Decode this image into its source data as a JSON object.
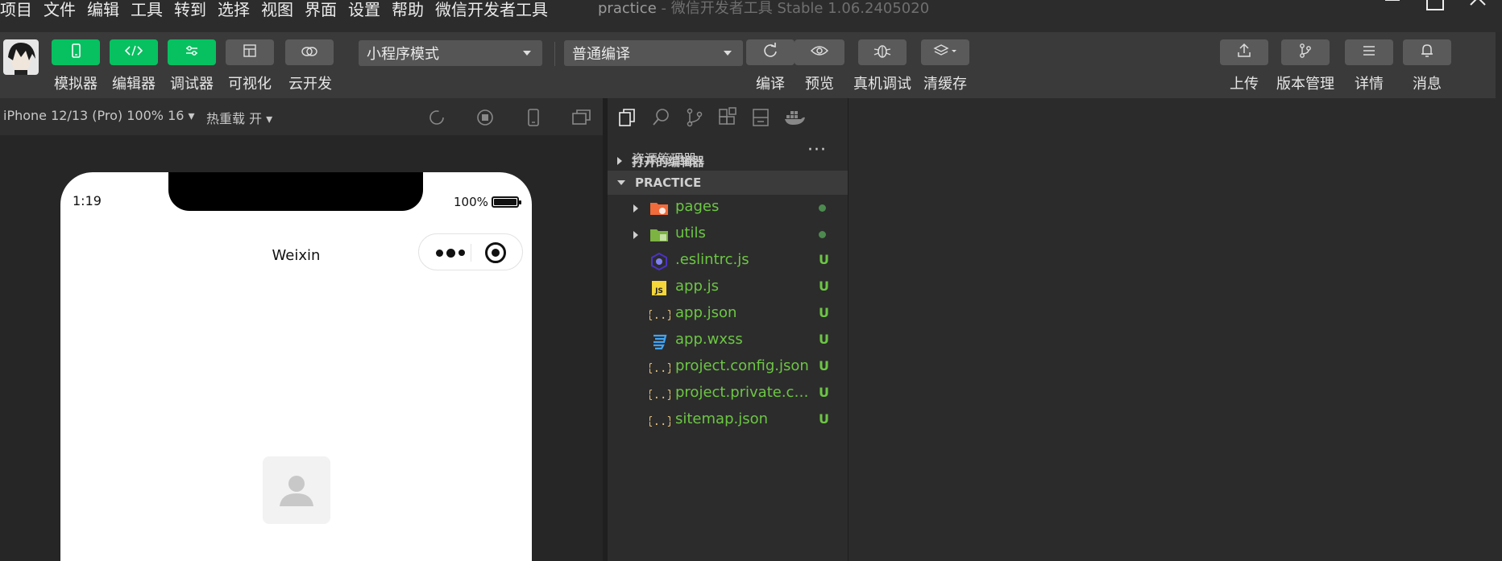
{
  "menu": [
    "项目",
    "文件",
    "编辑",
    "工具",
    "转到",
    "选择",
    "视图",
    "界面",
    "设置",
    "帮助",
    "微信开发者工具"
  ],
  "window": {
    "project": "practice",
    "subtitle": " - 微信开发者工具 Stable 1.06.2405020"
  },
  "toolbar": {
    "left_buttons": [
      {
        "label": "模拟器",
        "icon": "phone-icon",
        "active": true
      },
      {
        "label": "编辑器",
        "icon": "code-icon",
        "active": true
      },
      {
        "label": "调试器",
        "icon": "sliders-icon",
        "active": true
      },
      {
        "label": "可视化",
        "icon": "layout-icon",
        "active": false
      },
      {
        "label": "云开发",
        "icon": "cloud-icon",
        "active": false
      }
    ],
    "mode_select": "小程序模式",
    "compile_select": "普通编译",
    "mid_buttons": [
      {
        "label": "编译",
        "icon": "refresh-icon"
      },
      {
        "label": "预览",
        "icon": "eye-icon"
      },
      {
        "label": "真机调试",
        "icon": "bug-icon"
      },
      {
        "label": "清缓存",
        "icon": "layers-icon"
      }
    ],
    "right_buttons": [
      {
        "label": "上传",
        "icon": "upload-icon"
      },
      {
        "label": "版本管理",
        "icon": "branch-icon"
      },
      {
        "label": "详情",
        "icon": "menu-icon"
      },
      {
        "label": "消息",
        "icon": "bell-icon"
      }
    ]
  },
  "simulator": {
    "device": "iPhone 12/13 (Pro) 100% 16 ▾",
    "hot_reload": "热重载 开 ▾",
    "phone": {
      "time": "1:19",
      "battery": "100%",
      "nav_title": "Weixin"
    }
  },
  "explorer": {
    "title": "资源管理器",
    "more": "···",
    "sections": {
      "open_editors": "打开的编辑器",
      "project": "PRACTICE"
    },
    "files": [
      {
        "name": "pages",
        "type": "folder",
        "icon": "folder-pages-icon",
        "status": ""
      },
      {
        "name": "utils",
        "type": "folder",
        "icon": "folder-utils-icon",
        "status": ""
      },
      {
        "name": ".eslintrc.js",
        "type": "file",
        "icon": "eslint-icon",
        "status": "U"
      },
      {
        "name": "app.js",
        "type": "file",
        "icon": "js-icon",
        "status": "U"
      },
      {
        "name": "app.json",
        "type": "file",
        "icon": "json-icon",
        "status": "U"
      },
      {
        "name": "app.wxss",
        "type": "file",
        "icon": "css-icon",
        "status": "U"
      },
      {
        "name": "project.config.json",
        "type": "file",
        "icon": "json-icon",
        "status": "U"
      },
      {
        "name": "project.private.co...",
        "type": "file",
        "icon": "json-icon",
        "status": "U"
      },
      {
        "name": "sitemap.json",
        "type": "file",
        "icon": "json-icon",
        "status": "U"
      }
    ]
  }
}
